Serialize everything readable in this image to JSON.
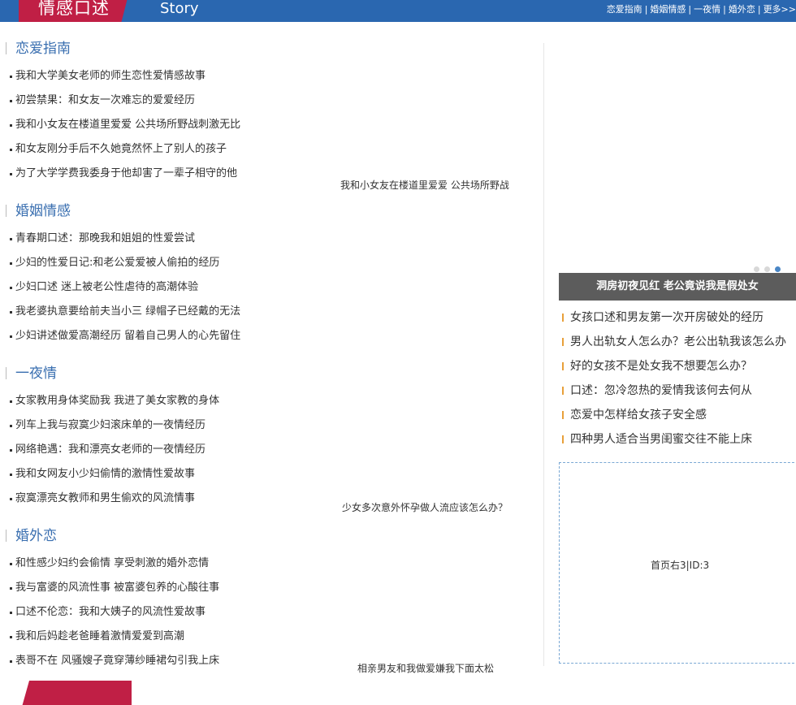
{
  "header": {
    "brand_cn": "情感口述",
    "brand_en": "Story",
    "links": [
      "恋爱指南",
      "婚姻情感",
      "一夜情",
      "婚外恋",
      "更多>>"
    ]
  },
  "sections": [
    {
      "title": "恋爱指南",
      "items": [
        "我和大学美女老师的师生恋性爱情感故事",
        "初尝禁果：和女友一次难忘的爱爱经历",
        "我和小女友在楼道里爱爱 公共场所野战刺激无比",
        "和女友刚分手后不久她竟然怀上了别人的孩子",
        "为了大学学费我委身于他却害了一辈子相守的他"
      ]
    },
    {
      "title": "婚姻情感",
      "items": [
        "青春期口述：那晚我和姐姐的性爱尝试",
        "少妇的性爱日记:和老公爱爱被人偷拍的经历",
        "少妇口述 迷上被老公性虐待的高潮体验",
        "我老婆执意要给前夫当小三 绿帽子已经戴的无法",
        "少妇讲述做爱高潮经历 留着自己男人的心先留住"
      ]
    },
    {
      "title": "一夜情",
      "items": [
        "女家教用身体奖励我 我进了美女家教的身体",
        "列车上我与寂寞少妇滚床单的一夜情经历",
        "网络艳遇：我和漂亮女老师的一夜情经历",
        "我和女网友小少妇偷情的激情性爱故事",
        "寂寞漂亮女教师和男生偷欢的风流情事"
      ]
    },
    {
      "title": "婚外恋",
      "items": [
        "和性感少妇约会偷情 享受刺激的婚外恋情",
        "我与富婆的风流性事 被富婆包养的心酸往事",
        "口述不伦恋：我和大姨子的风流性爱故事",
        "我和后妈趁老爸睡着激情爱爱到高潮",
        "表哥不在 风骚嫂子竟穿薄纱睡裙勾引我上床"
      ]
    }
  ],
  "captions": [
    "我和小女友在楼道里爱爱 公共场所野战",
    "少女多次意外怀孕做人流应该怎么办？",
    "相亲男友和我做爱嫌我下面太松"
  ],
  "right": {
    "banner": "洞房初夜见红 老公竟说我是假处女",
    "items": [
      "女孩口述和男友第一次开房破处的经历",
      "男人出轨女人怎么办？老公出轨我该怎么办",
      "好的女孩不是处女我不想要怎么办？",
      "口述：忽冷忽热的爱情我该何去何从",
      "恋爱中怎样给女孩子安全感",
      "四种男人适合当男闺蜜交往不能上床"
    ],
    "ad_label": "首页右3|ID:3"
  }
}
